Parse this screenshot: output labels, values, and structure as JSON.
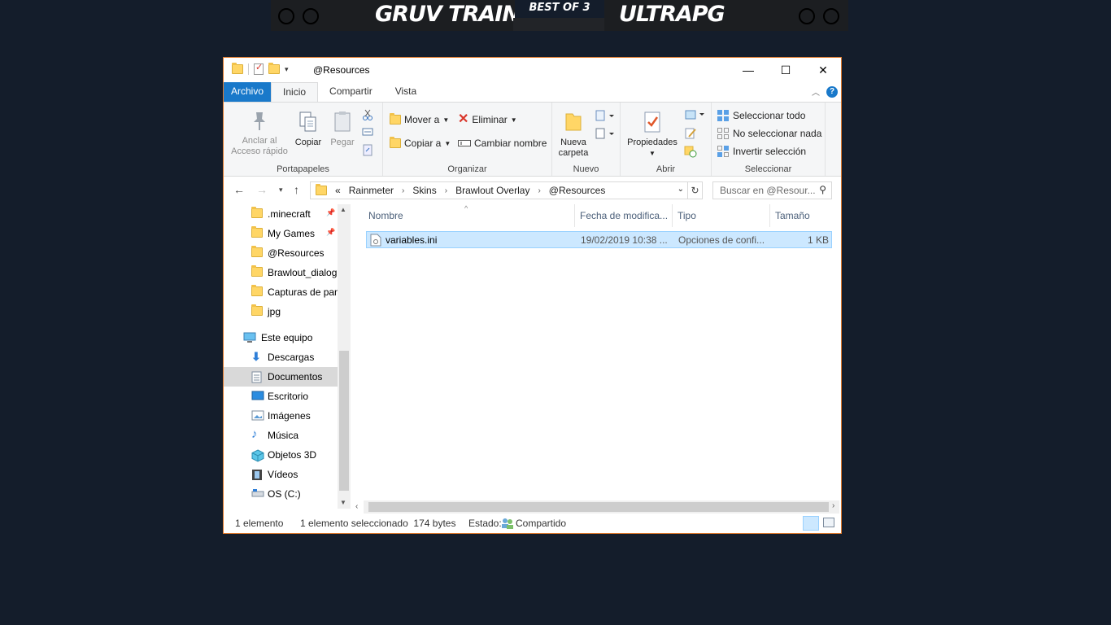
{
  "overlay": {
    "team_left": "GRUV TRAIN",
    "best_of": "BEST OF 3",
    "team_right": "ULTRAPG"
  },
  "window": {
    "title": "@Resources",
    "minimize": "—",
    "maximize": "☐",
    "close": "✕"
  },
  "tabs": [
    "Archivo",
    "Inicio",
    "Compartir",
    "Vista"
  ],
  "ribbon": {
    "portapapeles": {
      "label": "Portapapeles",
      "pin": "Anclar al Acceso rápido",
      "copy": "Copiar",
      "paste": "Pegar"
    },
    "organizar": {
      "label": "Organizar",
      "move": "Mover a",
      "copy_to": "Copiar a",
      "delete": "Eliminar",
      "rename": "Cambiar nombre"
    },
    "nuevo": {
      "label": "Nuevo",
      "new_folder": "Nueva carpeta"
    },
    "abrir": {
      "label": "Abrir",
      "properties": "Propiedades"
    },
    "seleccionar": {
      "label": "Seleccionar",
      "select_all": "Seleccionar todo",
      "select_none": "No seleccionar nada",
      "invert": "Invertir selección"
    }
  },
  "address": {
    "prefix": "«",
    "crumbs": [
      "Rainmeter",
      "Skins",
      "Brawlout Overlay",
      "@Resources"
    ],
    "search_placeholder": "Buscar en @Resour..."
  },
  "nav": {
    "quick": [
      {
        "label": ".minecraft",
        "pinned": true
      },
      {
        "label": "My Games",
        "pinned": true
      },
      {
        "label": "@Resources",
        "pinned": false
      },
      {
        "label": "Brawlout_dialog",
        "pinned": false
      },
      {
        "label": "Capturas de pan",
        "pinned": false
      },
      {
        "label": "jpg",
        "pinned": false
      }
    ],
    "this_pc": "Este equipo",
    "pc_items": [
      "Descargas",
      "Documentos",
      "Escritorio",
      "Imágenes",
      "Música",
      "Objetos 3D",
      "Vídeos",
      "OS (C:)"
    ],
    "selected": "Documentos"
  },
  "columns": [
    "Nombre",
    "Fecha de modifica...",
    "Tipo",
    "Tamaño"
  ],
  "files": [
    {
      "name": "variables.ini",
      "date": "19/02/2019 10:38 ...",
      "type": "Opciones de confi...",
      "size": "1 KB"
    }
  ],
  "status": {
    "count": "1 elemento",
    "selected": "1 elemento seleccionado  174 bytes",
    "state_label": "Estado:",
    "state_value": "Compartido"
  },
  "colors": {
    "accent": "#1979ca",
    "window_border": "#e07a2c",
    "selection": "#cce8ff",
    "background": "#141d2b"
  }
}
